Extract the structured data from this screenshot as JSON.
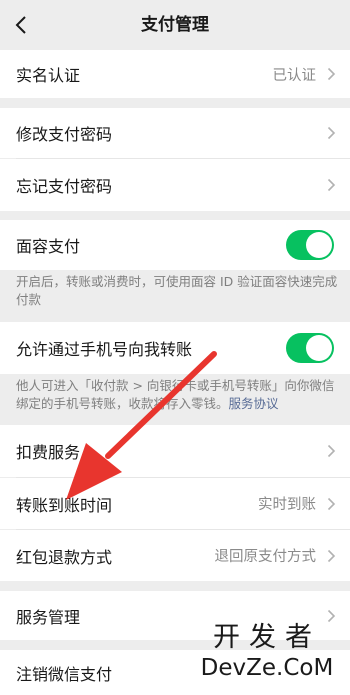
{
  "nav": {
    "title": "支付管理"
  },
  "real_name": {
    "label": "实名认证",
    "value": "已认证"
  },
  "change_password": {
    "label": "修改支付密码"
  },
  "forgot_password": {
    "label": "忘记支付密码"
  },
  "face_pay": {
    "label": "面容支付",
    "enabled": true,
    "note": "开启后，转账或消费时，可使用面容 ID 验证面容快速完成付款"
  },
  "phone_transfer": {
    "label": "允许通过手机号向我转账",
    "enabled": true,
    "note": "他人可进入「收付款 > 向银行卡或手机号转账」向你微信绑定的手机号转账，收款将存入零钱。",
    "note_link": "服务协议"
  },
  "deduction": {
    "label": "扣费服务"
  },
  "transfer_time": {
    "label": "转账到账时间",
    "value": "实时到账"
  },
  "red_packet_refund": {
    "label": "红包退款方式",
    "value": "退回原支付方式"
  },
  "service_manage": {
    "label": "服务管理"
  },
  "cancel_pay": {
    "label": "注销微信支付"
  },
  "watermark": {
    "cn": "开发者",
    "en": "DevZe.CoM"
  },
  "colors": {
    "accent": "#07c160",
    "link": "#576b95",
    "arrow": "#e8352e",
    "background": "#ededed"
  }
}
